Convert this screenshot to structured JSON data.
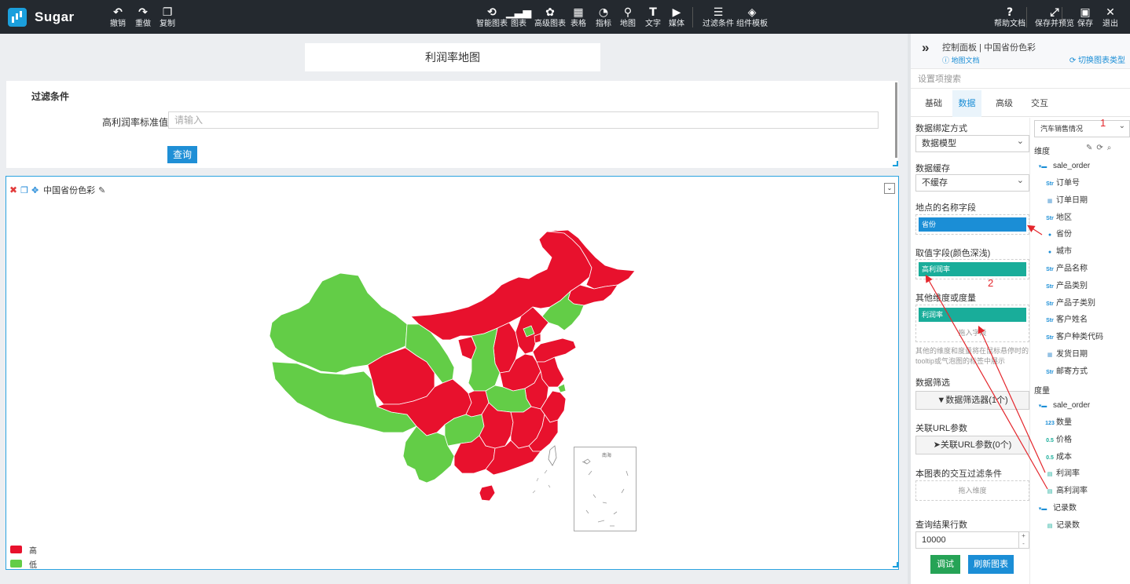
{
  "app": {
    "name": "Sugar"
  },
  "toolbar": {
    "left": [
      {
        "label": "撤销",
        "icon": "undo-icon",
        "glyph": "↶"
      },
      {
        "label": "重做",
        "icon": "redo-icon",
        "glyph": "↷"
      },
      {
        "label": "复制",
        "icon": "copy-icon",
        "glyph": "❐"
      }
    ],
    "center": [
      {
        "label": "智能图表",
        "icon": "smart-chart-icon",
        "glyph": "⟲"
      },
      {
        "label": "图表",
        "icon": "bar-chart-icon",
        "glyph": "▁▃▅"
      },
      {
        "label": "高级图表",
        "icon": "advanced-chart-icon",
        "glyph": "✿"
      },
      {
        "label": "表格",
        "icon": "table-icon",
        "glyph": "▦"
      },
      {
        "label": "指标",
        "icon": "gauge-icon",
        "glyph": "◔"
      },
      {
        "label": "地图",
        "icon": "map-pin-icon",
        "glyph": "⚲"
      },
      {
        "label": "文字",
        "icon": "text-icon",
        "glyph": "T"
      },
      {
        "label": "媒体",
        "icon": "media-icon",
        "glyph": "▶"
      },
      {
        "label": "过滤条件",
        "icon": "filter-list-icon",
        "glyph": "☰"
      },
      {
        "label": "组件模板",
        "icon": "template-icon",
        "glyph": "◈"
      }
    ],
    "right": [
      {
        "label": "帮助文档",
        "icon": "help-icon",
        "glyph": "?"
      },
      {
        "label": "保存并预览",
        "icon": "expand-icon",
        "glyph": "⤢"
      },
      {
        "label": "保存",
        "icon": "save-icon",
        "glyph": "▣"
      },
      {
        "label": "退出",
        "icon": "close-icon",
        "glyph": "✕"
      }
    ]
  },
  "canvas": {
    "title": "利润率地图",
    "filter": {
      "heading": "过滤条件",
      "label": "高利润率标准值",
      "placeholder": "请输入",
      "query_button": "查询"
    },
    "chart": {
      "title": "中国省份色彩",
      "legend": [
        {
          "label": "高",
          "color": "#e8112d"
        },
        {
          "label": "低",
          "color": "#63cd47"
        }
      ]
    }
  },
  "sidebar": {
    "header": {
      "breadcrumb": "控制面板 | 中国省份色彩",
      "doc_link": "地图文档",
      "switch_type": "切换图表类型"
    },
    "search_placeholder": "设置项搜索",
    "tabs": [
      "基础",
      "数据",
      "高级",
      "交互"
    ],
    "active_tab": "数据",
    "data": {
      "binding_label": "数据绑定方式",
      "binding_value": "数据模型",
      "cache_label": "数据缓存",
      "cache_value": "不缓存",
      "name_field_label": "地点的名称字段",
      "name_field_value": "省份",
      "value_field_label": "取值字段(颜色深浅)",
      "value_field_value": "高利润率",
      "other_label": "其他维度或度量",
      "other_value": "利润率",
      "drop_placeholder": "拖入字段",
      "other_hint": "其他的维度和度量将在鼠标悬停时的tooltip或气泡图的标签中展示",
      "filter_label": "数据筛选",
      "filter_button": "数据筛选器(1个)",
      "url_label": "关联URL参数",
      "url_button": "关联URL参数(0个)",
      "interaction_label": "本图表的交互过滤条件",
      "interaction_placeholder": "拖入维度",
      "rows_label": "查询结果行数",
      "rows_value": "10000",
      "debug_button": "调试",
      "refresh_button": "刷新图表"
    },
    "model": {
      "dataset": "汽车销售情况",
      "dimensions_label": "维度",
      "measures_label": "度量",
      "dim_group": "sale_order",
      "dimensions": [
        {
          "name": "订单号",
          "type": "Str"
        },
        {
          "name": "订单日期",
          "type": "date"
        },
        {
          "name": "地区",
          "type": "Str"
        },
        {
          "name": "省份",
          "type": "geo"
        },
        {
          "name": "城市",
          "type": "geo"
        },
        {
          "name": "产品名称",
          "type": "Str"
        },
        {
          "name": "产品类别",
          "type": "Str"
        },
        {
          "name": "产品子类别",
          "type": "Str"
        },
        {
          "name": "客户姓名",
          "type": "Str"
        },
        {
          "name": "客户种类代码",
          "type": "Str"
        },
        {
          "name": "发货日期",
          "type": "date"
        },
        {
          "name": "邮寄方式",
          "type": "Str"
        }
      ],
      "measure_group": "sale_order",
      "measures": [
        {
          "name": "数量",
          "type": "123"
        },
        {
          "name": "价格",
          "type": "0.5"
        },
        {
          "name": "成本",
          "type": "0.5"
        },
        {
          "name": "利润率",
          "type": "calc"
        },
        {
          "name": "高利润率",
          "type": "calc"
        }
      ],
      "count_group": "记录数",
      "count_items": [
        {
          "name": "记录数",
          "type": "calc"
        }
      ]
    },
    "annotations": [
      "1",
      "2"
    ]
  }
}
